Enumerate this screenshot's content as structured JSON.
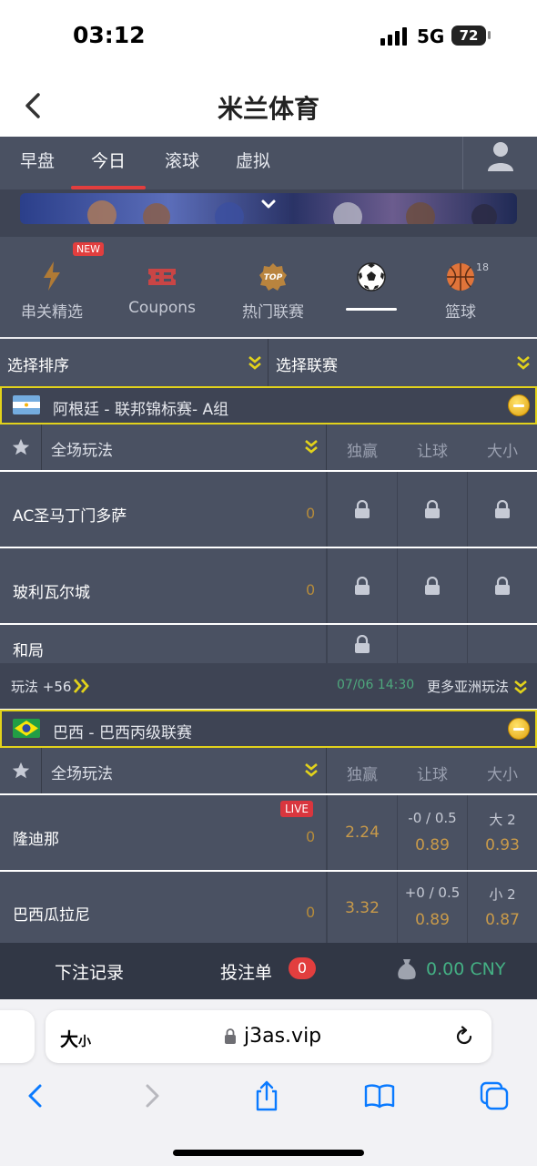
{
  "status": {
    "time": "03:12",
    "network": "5G",
    "battery": "72"
  },
  "nav": {
    "title": "米兰体育"
  },
  "tabs": [
    {
      "label": "早盘"
    },
    {
      "label": "今日"
    },
    {
      "label": "滚球"
    },
    {
      "label": "虚拟"
    }
  ],
  "sports": {
    "items": [
      {
        "label": "串关精选",
        "icon": "lightning-icon",
        "badge": "NEW"
      },
      {
        "label": "Coupons",
        "icon": "ticket-icon"
      },
      {
        "label": "热门联赛",
        "icon": "top-badge-icon",
        "icon_text": "TOP"
      },
      {
        "label": "",
        "icon": "soccer-ball-icon"
      },
      {
        "label": "篮球",
        "icon": "basketball-icon",
        "count": "18"
      }
    ]
  },
  "filters": {
    "sort": "选择排序",
    "league": "选择联赛"
  },
  "leagues": [
    {
      "name": "阿根廷 - 联邦锦标赛- A组",
      "market": "全场玩法",
      "cols": [
        "独赢",
        "让球",
        "大小"
      ],
      "teams": [
        {
          "name": "AC圣马丁门多萨",
          "score": "0"
        },
        {
          "name": "玻利瓦尔城",
          "score": "0"
        },
        {
          "name": "和局"
        }
      ],
      "meta": {
        "more_plays": "玩法 +56",
        "time": "07/06 14:30",
        "more_asian": "更多亚洲玩法"
      }
    },
    {
      "name": "巴西 - 巴西丙级联赛",
      "market": "全场玩法",
      "cols": [
        "独赢",
        "让球",
        "大小"
      ],
      "teams": [
        {
          "name": "隆迪那",
          "score": "0",
          "live": "LIVE",
          "win": "2.24",
          "hcp_line": "-0 / 0.5",
          "hcp": "0.89",
          "ou_line": "大 2",
          "ou": "0.93"
        },
        {
          "name": "巴西瓜拉尼",
          "score": "0",
          "win": "3.32",
          "hcp_line": "+0 / 0.5",
          "hcp": "0.89",
          "ou_line": "小 2",
          "ou": "0.87"
        }
      ]
    }
  ],
  "betbar": {
    "history": "下注记录",
    "slip": "投注单",
    "slip_count": "0",
    "balance": "0.00 CNY"
  },
  "browser": {
    "text_size_big": "大",
    "text_size_small": "小",
    "url": "j3as.vip"
  },
  "colors": {
    "accent": "#e23e3e",
    "panel": "#4a5162",
    "highlight": "#e2d21b",
    "positive": "#44b084",
    "odds": "#c89a4a"
  }
}
